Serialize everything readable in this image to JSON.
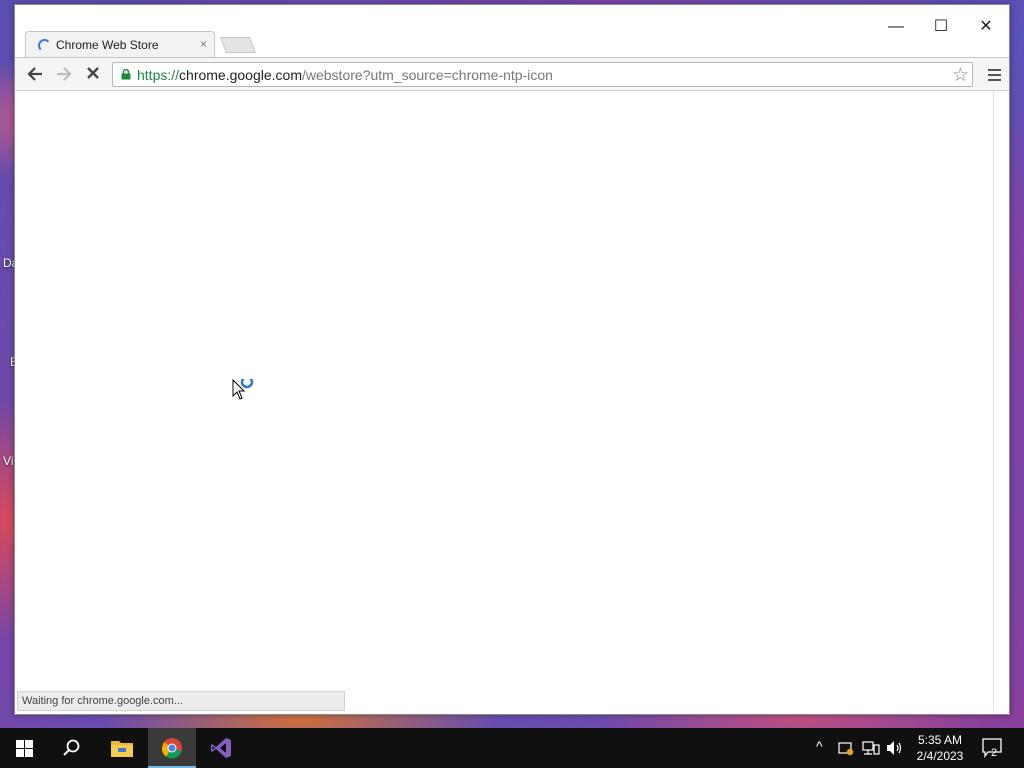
{
  "desktop": {
    "labels": [
      "Da",
      "E",
      "Vi"
    ]
  },
  "browser": {
    "tab": {
      "title": "Chrome Web Store",
      "close": "×"
    },
    "window_controls": {
      "minimize": "—",
      "maximize": "☐",
      "close": "✕"
    },
    "url": {
      "scheme": "https://",
      "host": "chrome.google.com",
      "path": "/webstore?utm_source=chrome-ntp-icon"
    },
    "status_text": "Waiting for chrome.google.com...",
    "loading": true
  },
  "taskbar": {
    "apps": [
      "start",
      "search",
      "file-explorer",
      "chrome",
      "visual-studio"
    ],
    "active_app": "chrome",
    "clock": {
      "time": "5:35 AM",
      "date": "2/4/2023"
    },
    "notification_count": "2"
  },
  "colors": {
    "secure_scheme": "#1a8a3b",
    "taskbar": "#101010",
    "spinner": "#3a7bd5"
  }
}
